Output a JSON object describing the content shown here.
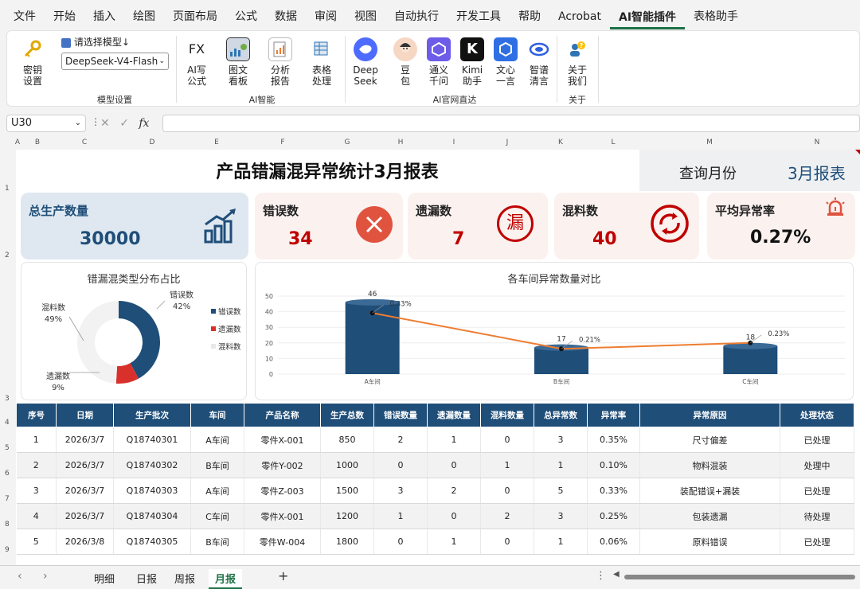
{
  "menu": [
    "文件",
    "开始",
    "插入",
    "绘图",
    "页面布局",
    "公式",
    "数据",
    "审阅",
    "视图",
    "自动执行",
    "开发工具",
    "帮助",
    "Acrobat",
    "AI智能插件",
    "表格助手"
  ],
  "menu_active_index": 13,
  "ribbon": {
    "key_btn": "密钥\n设置",
    "model_label": "请选择模型↓",
    "model_value": "DeepSeek-V4-Flash",
    "group_model": "模型设置",
    "ai_formula": "AI写\n公式",
    "chart_board": "图文\n看板",
    "analysis": "分析\n报告",
    "table_proc": "表格\n处理",
    "group_ai": "AI智能",
    "deepseek": "Deep\nSeek",
    "doubao": "豆\n包",
    "qianwen": "通义\n千问",
    "kimi": "Kimi\n助手",
    "wenxin": "文心\n一言",
    "zhipu": "智谱\n清言",
    "group_sites": "AI官网直达",
    "about": "关于\n我们",
    "group_about": "关于",
    "fx_icon_text": "FX",
    "kimi_icon_text": "K"
  },
  "formula": {
    "cell": "U30",
    "fx": "fx",
    "content": ""
  },
  "columns": [
    "A",
    "B",
    "C",
    "D",
    "E",
    "F",
    "G",
    "H",
    "I",
    "J",
    "K",
    "L",
    "M",
    "N"
  ],
  "rows": [
    "1",
    "2",
    "3",
    "4",
    "5",
    "6",
    "7",
    "8",
    "9"
  ],
  "report": {
    "title": "产品错漏混异常统计3月报表",
    "query_label": "查询月份",
    "query_value": "3月报表"
  },
  "cards": {
    "total_label": "总生产数量",
    "total_value": "30000",
    "error_label": "错误数",
    "error_value": "34",
    "missing_label": "遗漏数",
    "missing_value": "7",
    "missing_glyph": "漏",
    "mixed_label": "混料数",
    "mixed_value": "40",
    "rate_label": "平均异常率",
    "rate_value": "0.27%"
  },
  "colors": {
    "navy": "#1f4e79",
    "red": "#c00000",
    "bright_red": "#d9302c",
    "orange": "#ed7d31",
    "card_bg": "#fbf1ee",
    "blue_card": "#dfe8f1"
  },
  "chart_data": [
    {
      "type": "pie",
      "title": "错漏混类型分布占比",
      "categories": [
        "错误数",
        "遗漏数",
        "混料数"
      ],
      "values": [
        42,
        9,
        49
      ],
      "value_labels": [
        "42%",
        "9%",
        "49%"
      ],
      "colors": [
        "#1f4e79",
        "#d9302c",
        "#f2f2f2"
      ],
      "legend": "right"
    },
    {
      "type": "bar",
      "title": "各车间异常数量对比",
      "categories": [
        "A车间",
        "B车间",
        "C车间"
      ],
      "series": [
        {
          "type": "bar",
          "values": [
            46,
            17,
            18
          ]
        },
        {
          "type": "line",
          "values": [
            0.33,
            0.21,
            0.23
          ],
          "labels": [
            "0.33%",
            "0.21%",
            "0.23%"
          ]
        }
      ],
      "ylim": [
        0,
        50
      ],
      "yticks": [
        "0",
        "10",
        "20",
        "30",
        "40",
        "50"
      ]
    }
  ],
  "table": {
    "headers": [
      "序号",
      "日期",
      "生产批次",
      "车间",
      "产品名称",
      "生产总数",
      "错误数量",
      "遗漏数量",
      "混料数量",
      "总异常数",
      "异常率",
      "异常原因",
      "处理状态"
    ],
    "rows": [
      [
        "1",
        "2026/3/7",
        "Q18740301",
        "A车间",
        "零件X-001",
        "850",
        "2",
        "1",
        "0",
        "3",
        "0.35%",
        "尺寸偏差",
        "已处理"
      ],
      [
        "2",
        "2026/3/7",
        "Q18740302",
        "B车间",
        "零件Y-002",
        "1000",
        "0",
        "0",
        "1",
        "1",
        "0.10%",
        "物料混装",
        "处理中"
      ],
      [
        "3",
        "2026/3/7",
        "Q18740303",
        "A车间",
        "零件Z-003",
        "1500",
        "3",
        "2",
        "0",
        "5",
        "0.33%",
        "装配错误+漏装",
        "已处理"
      ],
      [
        "4",
        "2026/3/7",
        "Q18740304",
        "C车间",
        "零件X-001",
        "1200",
        "1",
        "0",
        "2",
        "3",
        "0.25%",
        "包装遗漏",
        "待处理"
      ],
      [
        "5",
        "2026/3/8",
        "Q18740305",
        "B车间",
        "零件W-004",
        "1800",
        "0",
        "1",
        "0",
        "1",
        "0.06%",
        "原料错误",
        "已处理"
      ]
    ]
  },
  "tabs": [
    "明细",
    "日报",
    "周报",
    "月报"
  ],
  "active_tab": 3,
  "add_tab": "+"
}
